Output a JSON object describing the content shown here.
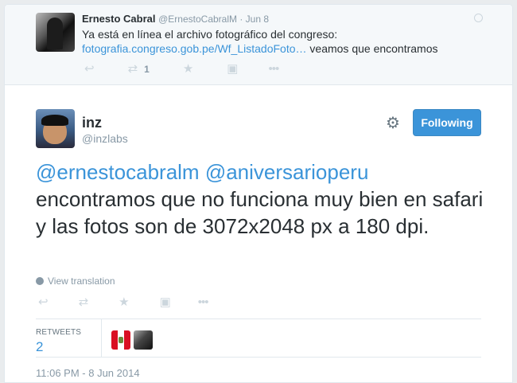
{
  "ancestor_tweet": {
    "name": "Ernesto Cabral",
    "handle": "@ErnestoCabralM",
    "separator": " · ",
    "time": "Jun 8",
    "text": "Ya está en línea el archivo fotográfico del congreso:",
    "link": "fotografia.congreso.gob.pe/Wf_ListadoFoto…",
    "text_after_link": " veamos que encontramos",
    "retweet_count": "1"
  },
  "main_tweet": {
    "name": "inz",
    "handle": "@inzlabs",
    "follow_label": "Following",
    "mention1": "@ernestocabralm",
    "mention2": "@aniversarioperu",
    "body": "encontramos que no funciona muy bien en safari y las fotos son de 3072x2048 px a 180 dpi.",
    "view_translation": "View translation",
    "retweets_label": "RETWEETS",
    "retweets_count": "2",
    "timestamp": "11:06 PM - 8 Jun 2014"
  },
  "icons": {
    "reply": "↩",
    "retweet": "⇄",
    "favorite": "★",
    "media": "▣",
    "more": "•••",
    "gear": "⚙"
  },
  "colors": {
    "link": "#3b94d9",
    "follow_button": "#3b94d9",
    "muted": "#8899a6"
  }
}
